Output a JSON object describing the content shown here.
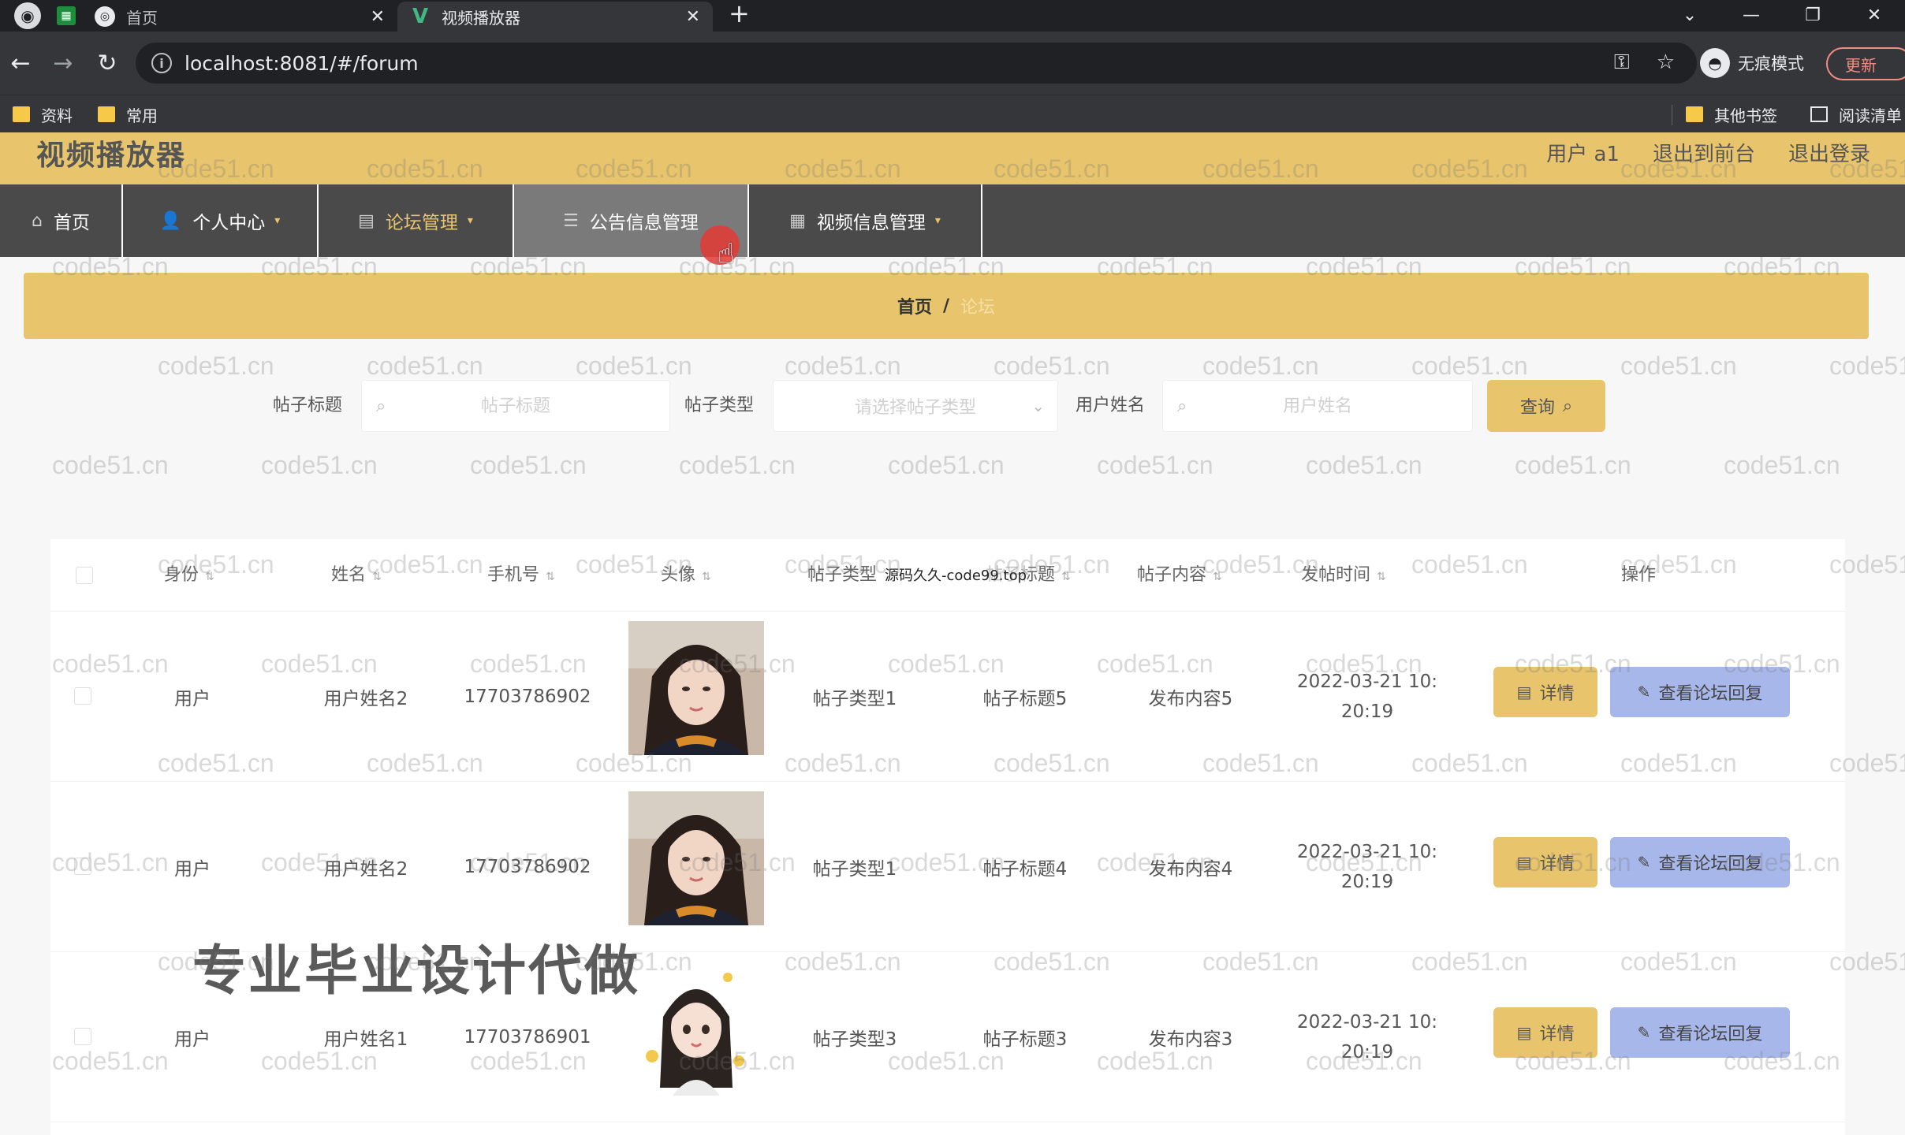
{
  "browser": {
    "tabs": [
      {
        "label": "首页",
        "active": false
      },
      {
        "label": "视频播放器",
        "active": true
      }
    ],
    "url": "localhost:8081/#/forum",
    "incognito_label": "无痕模式",
    "update_label": "更新",
    "bookmarks": [
      "资料",
      "常用"
    ],
    "other_bookmarks": "其他书签",
    "reading_list": "阅读清单"
  },
  "app": {
    "title": "视频播放器",
    "user_label": "用户 a1",
    "exit_front": "退出到前台",
    "logout": "退出登录",
    "nav": [
      {
        "label": "首页",
        "icon": "home-icon"
      },
      {
        "label": "个人中心",
        "icon": "user-icon"
      },
      {
        "label": "论坛管理",
        "icon": "clipboard-icon"
      },
      {
        "label": "公告信息管理",
        "icon": "notice-icon"
      },
      {
        "label": "视频信息管理",
        "icon": "grid-icon"
      }
    ]
  },
  "breadcrumb": {
    "home": "首页",
    "separator": "/",
    "current": "论坛"
  },
  "search": {
    "title_label": "帖子标题",
    "title_placeholder": "帖子标题",
    "type_label": "帖子类型",
    "type_placeholder": "请选择帖子类型",
    "name_label": "用户姓名",
    "name_placeholder": "用户姓名",
    "query_label": "查询"
  },
  "table": {
    "headers": {
      "identity": "身份",
      "name": "姓名",
      "phone": "手机号",
      "avatar": "头像",
      "post_type": "帖子类型",
      "post_title": "帖子标题",
      "post_content": "帖子内容",
      "post_time": "发帖时间",
      "actions": "操作"
    },
    "rows": [
      {
        "identity": "用户",
        "name": "用户姓名2",
        "phone": "17703786902",
        "post_type": "帖子类型1",
        "post_title": "帖子标题5",
        "post_content": "发布内容5",
        "time_line1": "2022-03-21 10:",
        "time_line2": "20:19"
      },
      {
        "identity": "用户",
        "name": "用户姓名2",
        "phone": "17703786902",
        "post_type": "帖子类型1",
        "post_title": "帖子标题4",
        "post_content": "发布内容4",
        "time_line1": "2022-03-21 10:",
        "time_line2": "20:19"
      },
      {
        "identity": "用户",
        "name": "用户姓名1",
        "phone": "17703786901",
        "post_type": "帖子类型3",
        "post_title": "帖子标题3",
        "post_content": "发布内容3",
        "time_line1": "2022-03-21 10:",
        "time_line2": "20:19"
      }
    ],
    "detail_label": "详情",
    "reply_label": "查看论坛回复"
  },
  "overlay_text": "源码久久-code99.top",
  "promo_text": "专业毕业设计代做",
  "watermark": "code51.cn"
}
